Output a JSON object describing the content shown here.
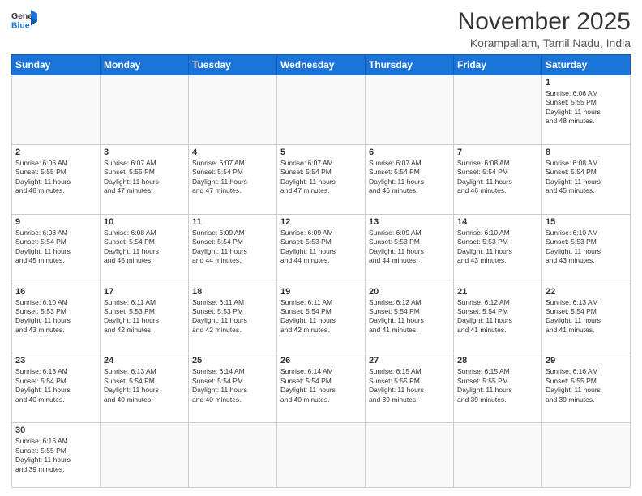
{
  "header": {
    "logo_general": "General",
    "logo_blue": "Blue",
    "month_title": "November 2025",
    "subtitle": "Korampallam, Tamil Nadu, India"
  },
  "days_of_week": [
    "Sunday",
    "Monday",
    "Tuesday",
    "Wednesday",
    "Thursday",
    "Friday",
    "Saturday"
  ],
  "weeks": [
    [
      {
        "day": "",
        "info": ""
      },
      {
        "day": "",
        "info": ""
      },
      {
        "day": "",
        "info": ""
      },
      {
        "day": "",
        "info": ""
      },
      {
        "day": "",
        "info": ""
      },
      {
        "day": "",
        "info": ""
      },
      {
        "day": "1",
        "info": "Sunrise: 6:06 AM\nSunset: 5:55 PM\nDaylight: 11 hours\nand 48 minutes."
      }
    ],
    [
      {
        "day": "2",
        "info": "Sunrise: 6:06 AM\nSunset: 5:55 PM\nDaylight: 11 hours\nand 48 minutes."
      },
      {
        "day": "3",
        "info": "Sunrise: 6:07 AM\nSunset: 5:55 PM\nDaylight: 11 hours\nand 47 minutes."
      },
      {
        "day": "4",
        "info": "Sunrise: 6:07 AM\nSunset: 5:54 PM\nDaylight: 11 hours\nand 47 minutes."
      },
      {
        "day": "5",
        "info": "Sunrise: 6:07 AM\nSunset: 5:54 PM\nDaylight: 11 hours\nand 47 minutes."
      },
      {
        "day": "6",
        "info": "Sunrise: 6:07 AM\nSunset: 5:54 PM\nDaylight: 11 hours\nand 46 minutes."
      },
      {
        "day": "7",
        "info": "Sunrise: 6:08 AM\nSunset: 5:54 PM\nDaylight: 11 hours\nand 46 minutes."
      },
      {
        "day": "8",
        "info": "Sunrise: 6:08 AM\nSunset: 5:54 PM\nDaylight: 11 hours\nand 45 minutes."
      }
    ],
    [
      {
        "day": "9",
        "info": "Sunrise: 6:08 AM\nSunset: 5:54 PM\nDaylight: 11 hours\nand 45 minutes."
      },
      {
        "day": "10",
        "info": "Sunrise: 6:08 AM\nSunset: 5:54 PM\nDaylight: 11 hours\nand 45 minutes."
      },
      {
        "day": "11",
        "info": "Sunrise: 6:09 AM\nSunset: 5:54 PM\nDaylight: 11 hours\nand 44 minutes."
      },
      {
        "day": "12",
        "info": "Sunrise: 6:09 AM\nSunset: 5:53 PM\nDaylight: 11 hours\nand 44 minutes."
      },
      {
        "day": "13",
        "info": "Sunrise: 6:09 AM\nSunset: 5:53 PM\nDaylight: 11 hours\nand 44 minutes."
      },
      {
        "day": "14",
        "info": "Sunrise: 6:10 AM\nSunset: 5:53 PM\nDaylight: 11 hours\nand 43 minutes."
      },
      {
        "day": "15",
        "info": "Sunrise: 6:10 AM\nSunset: 5:53 PM\nDaylight: 11 hours\nand 43 minutes."
      }
    ],
    [
      {
        "day": "16",
        "info": "Sunrise: 6:10 AM\nSunset: 5:53 PM\nDaylight: 11 hours\nand 43 minutes."
      },
      {
        "day": "17",
        "info": "Sunrise: 6:11 AM\nSunset: 5:53 PM\nDaylight: 11 hours\nand 42 minutes."
      },
      {
        "day": "18",
        "info": "Sunrise: 6:11 AM\nSunset: 5:53 PM\nDaylight: 11 hours\nand 42 minutes."
      },
      {
        "day": "19",
        "info": "Sunrise: 6:11 AM\nSunset: 5:54 PM\nDaylight: 11 hours\nand 42 minutes."
      },
      {
        "day": "20",
        "info": "Sunrise: 6:12 AM\nSunset: 5:54 PM\nDaylight: 11 hours\nand 41 minutes."
      },
      {
        "day": "21",
        "info": "Sunrise: 6:12 AM\nSunset: 5:54 PM\nDaylight: 11 hours\nand 41 minutes."
      },
      {
        "day": "22",
        "info": "Sunrise: 6:13 AM\nSunset: 5:54 PM\nDaylight: 11 hours\nand 41 minutes."
      }
    ],
    [
      {
        "day": "23",
        "info": "Sunrise: 6:13 AM\nSunset: 5:54 PM\nDaylight: 11 hours\nand 40 minutes."
      },
      {
        "day": "24",
        "info": "Sunrise: 6:13 AM\nSunset: 5:54 PM\nDaylight: 11 hours\nand 40 minutes."
      },
      {
        "day": "25",
        "info": "Sunrise: 6:14 AM\nSunset: 5:54 PM\nDaylight: 11 hours\nand 40 minutes."
      },
      {
        "day": "26",
        "info": "Sunrise: 6:14 AM\nSunset: 5:54 PM\nDaylight: 11 hours\nand 40 minutes."
      },
      {
        "day": "27",
        "info": "Sunrise: 6:15 AM\nSunset: 5:55 PM\nDaylight: 11 hours\nand 39 minutes."
      },
      {
        "day": "28",
        "info": "Sunrise: 6:15 AM\nSunset: 5:55 PM\nDaylight: 11 hours\nand 39 minutes."
      },
      {
        "day": "29",
        "info": "Sunrise: 6:16 AM\nSunset: 5:55 PM\nDaylight: 11 hours\nand 39 minutes."
      }
    ],
    [
      {
        "day": "30",
        "info": "Sunrise: 6:16 AM\nSunset: 5:55 PM\nDaylight: 11 hours\nand 39 minutes."
      },
      {
        "day": "",
        "info": ""
      },
      {
        "day": "",
        "info": ""
      },
      {
        "day": "",
        "info": ""
      },
      {
        "day": "",
        "info": ""
      },
      {
        "day": "",
        "info": ""
      },
      {
        "day": "",
        "info": ""
      }
    ]
  ]
}
